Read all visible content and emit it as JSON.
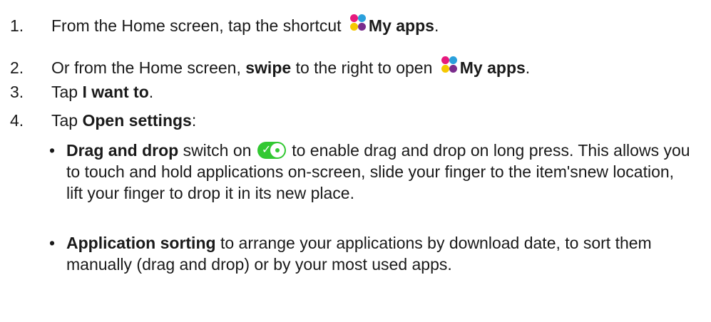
{
  "colors": {
    "text": "#1a1a1a",
    "toggle_on": "#32c832",
    "app_dot_pink": "#e6197d",
    "app_dot_blue": "#2aa0dc",
    "app_dot_yellow": "#f5c800",
    "app_dot_purple": "#7a2c8c"
  },
  "steps": [
    {
      "number": "1.",
      "text_before": "From the Home screen, tap the shortcut",
      "icon": "my-apps-icon",
      "bold": "My apps",
      "text_after": "."
    },
    {
      "number": "2.",
      "text_before": "Or from the Home screen,",
      "bold_1": "swipe",
      "text_middle": "to the right to open",
      "icon": "my-apps-icon",
      "bold_2": "My apps",
      "text_after": "."
    },
    {
      "number": "3.",
      "text_before": "Tap",
      "bold": "I want to",
      "text_after": "."
    },
    {
      "number": "4.",
      "text_before": "Tap",
      "bold": "Open settings",
      "text_after": ":"
    }
  ],
  "bullets": [
    {
      "bullet": "•",
      "bold": "Drag and drop",
      "text_before_icon": "switch on",
      "icon": "toggle-switch-on-icon",
      "text": "to enable drag and drop on long press. This allows you to touch and hold applications on-screen, slide your finger to the item'snew location, lift your finger to drop it in its new place."
    },
    {
      "bullet": "•",
      "bold": "Application sorting",
      "text": "to arrange your applications by download date, to sort them manually (drag and drop) or by your most used apps."
    }
  ]
}
